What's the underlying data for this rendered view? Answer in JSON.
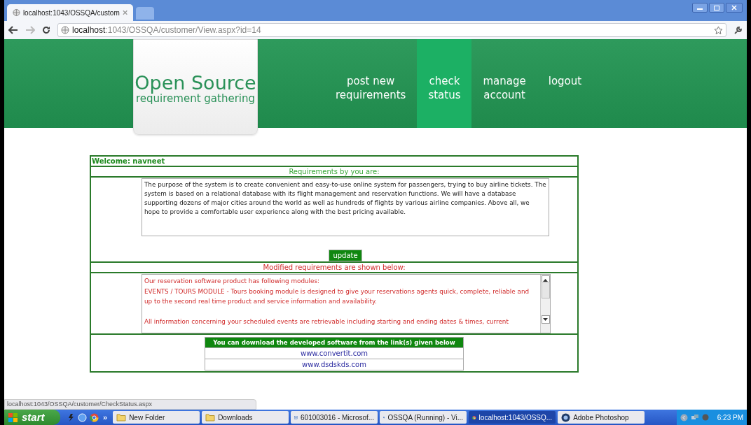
{
  "browser": {
    "tab_title": "localhost:1043/OSSQA/custom",
    "url_host": "localhost",
    "url_path": ":1043/OSSQA/customer/View.aspx?id=14"
  },
  "header": {
    "logo_title": "Open Source",
    "logo_subtitle": "requirement gathering",
    "nav": [
      {
        "lines": [
          "post new",
          "requirements"
        ],
        "selected": false
      },
      {
        "lines": [
          "check",
          "status"
        ],
        "selected": true
      },
      {
        "lines": [
          "manage",
          "account"
        ],
        "selected": false
      },
      {
        "lines": [
          "logout"
        ],
        "selected": false
      }
    ]
  },
  "page": {
    "welcome": "Welcome: navneet",
    "requirements_heading": "Requirements by you are:",
    "requirements_text": "The purpose of the system is to create convenient and easy-to-use online system for passengers, trying to buy airline tickets. The system is based on a relational database with its flight management and reservation functions. We will have a database supporting dozens of major cities around the world as well as hundreds of flights by various airline companies. Above all, we hope to provide a comfortable user experience along with the best pricing available.",
    "update_button": "update",
    "modified_heading": "Modified requirements are shown below:",
    "modified_text": "Our reservation software product has following modules:\nEVENTS / TOURS MODULE - Tours booking module is designed to give your reservations agents quick, complete, reliable and up to the second real time product and service information and availability.\n\nAll information concerning your scheduled events are retrievable including starting and ending dates & times, current",
    "download_heading": "You can download the developed software from the link(s) given below",
    "links": [
      "www.convertit.com",
      "www.dsdskds.com"
    ]
  },
  "status_url": "localhost:1043/OSSQA/customer/CheckStatus.aspx",
  "taskbar": {
    "start": "start",
    "more": "»",
    "tasks": [
      {
        "label": "New Folder",
        "kind": "folder",
        "selected": false
      },
      {
        "label": "Downloads",
        "kind": "folder",
        "selected": false
      },
      {
        "label": "601003016 - Microsof...",
        "kind": "document",
        "selected": false
      },
      {
        "label": "OSSQA (Running) - Vi...",
        "kind": "vm",
        "selected": false
      },
      {
        "label": "localhost:1043/OSSQ...",
        "kind": "browser",
        "selected": true
      },
      {
        "label": "Adobe Photoshop",
        "kind": "app",
        "selected": false
      }
    ],
    "clock": "6:23 PM"
  }
}
